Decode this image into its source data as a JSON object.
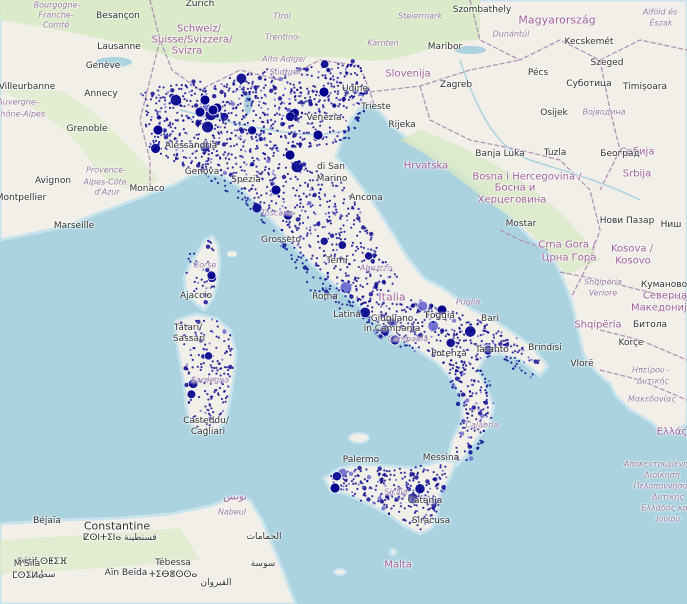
{
  "colors": {
    "sea": "#aad3df",
    "land": "#f2efe9",
    "green": "#cfe7b8",
    "border": "#b093b5",
    "coast_halo": "#c8e3ec",
    "marker_fill": "#00008b",
    "marker_light": "#6666cc"
  },
  "labels": {
    "countries": [
      {
        "id": "slovenija",
        "text": "Slovenija"
      },
      {
        "id": "hrvatska",
        "text": "Hrvatska"
      },
      {
        "id": "bosna",
        "text": "Bosna i Hercegovina /"
      },
      {
        "id": "bosna2",
        "text": "Босна и"
      },
      {
        "id": "bosna3",
        "text": "Херцеговина"
      },
      {
        "id": "magyar",
        "text": "Magyarország"
      },
      {
        "id": "srbija",
        "text": "Србија"
      },
      {
        "id": "srbija2",
        "text": "Srbija"
      },
      {
        "id": "cg",
        "text": "Crna Gora /"
      },
      {
        "id": "cg2",
        "text": "Црна Гора"
      },
      {
        "id": "kosovo",
        "text": "Kosova /"
      },
      {
        "id": "kosovo2",
        "text": "Kosovo"
      },
      {
        "id": "shqiperia",
        "text": "Shqipëria"
      },
      {
        "id": "makedonija",
        "text": "Северна"
      },
      {
        "id": "makedonija2",
        "text": "Македонија"
      },
      {
        "id": "italia",
        "text": "Italia"
      },
      {
        "id": "schweiz",
        "text": "Schweiz/"
      },
      {
        "id": "schweiz2",
        "text": "Suisse/Svizzera/"
      },
      {
        "id": "schweiz3",
        "text": "Svizra"
      },
      {
        "id": "ellas",
        "text": "Ελλάς"
      },
      {
        "id": "tunis",
        "text": "تونس"
      },
      {
        "id": "malta",
        "text": "Malta"
      }
    ],
    "cities": [
      {
        "id": "zurich",
        "text": "Zürich"
      },
      {
        "id": "besancon",
        "text": "Besançon"
      },
      {
        "id": "lausanne",
        "text": "Lausanne"
      },
      {
        "id": "geneve",
        "text": "Genève"
      },
      {
        "id": "annecy",
        "text": "Annecy"
      },
      {
        "id": "villeurbanne",
        "text": "Villeurbanne"
      },
      {
        "id": "grenoble",
        "text": "Grenoble"
      },
      {
        "id": "avignon",
        "text": "Avignon"
      },
      {
        "id": "montpellier",
        "text": "Montpellier"
      },
      {
        "id": "marseille",
        "text": "Marseille"
      },
      {
        "id": "monaco",
        "text": "Monaco"
      },
      {
        "id": "genova",
        "text": "Genova"
      },
      {
        "id": "alessandria",
        "text": "Alessandria"
      },
      {
        "id": "spezia",
        "text": "Spezia"
      },
      {
        "id": "grosseto",
        "text": "Grosseto"
      },
      {
        "id": "venezia",
        "text": "Venezia"
      },
      {
        "id": "udine",
        "text": "Udine"
      },
      {
        "id": "trieste",
        "text": "Trieste"
      },
      {
        "id": "rijeka",
        "text": "Rijeka"
      },
      {
        "id": "zagreb",
        "text": "Zagreb"
      },
      {
        "id": "maribor",
        "text": "Maribor"
      },
      {
        "id": "szombathely",
        "text": "Szombathely"
      },
      {
        "id": "kecskemet",
        "text": "Kecskemét"
      },
      {
        "id": "szeged",
        "text": "Szeged"
      },
      {
        "id": "pecs",
        "text": "Pécs"
      },
      {
        "id": "osijek",
        "text": "Osijek"
      },
      {
        "id": "subotica",
        "text": "Суботица"
      },
      {
        "id": "timisoara",
        "text": "Timișoara"
      },
      {
        "id": "banjaluka",
        "text": "Banja Luka"
      },
      {
        "id": "tuzla",
        "text": "Tuzla"
      },
      {
        "id": "beograd",
        "text": "Београд"
      },
      {
        "id": "mostar",
        "text": "Mostar"
      },
      {
        "id": "novipazar",
        "text": "Нови Пазар"
      },
      {
        "id": "nis",
        "text": "Ниш"
      },
      {
        "id": "kumanovo",
        "text": "Куманово"
      },
      {
        "id": "bitola",
        "text": "Битола"
      },
      {
        "id": "korce",
        "text": "Korçe"
      },
      {
        "id": "vlore",
        "text": "Vlorë"
      },
      {
        "id": "sanmarino",
        "text": "di San"
      },
      {
        "id": "sanmarino2",
        "text": "Marino"
      },
      {
        "id": "ancona",
        "text": "Ancona"
      },
      {
        "id": "terni",
        "text": "Terni"
      },
      {
        "id": "roma",
        "text": "Roma"
      },
      {
        "id": "latina",
        "text": "Latina"
      },
      {
        "id": "giugliano",
        "text": "Giugliano"
      },
      {
        "id": "giugliano2",
        "text": "in Campania"
      },
      {
        "id": "foggia",
        "text": "Foggia"
      },
      {
        "id": "bari",
        "text": "Bari"
      },
      {
        "id": "taranto",
        "text": "Taranto"
      },
      {
        "id": "brindisi",
        "text": "Brindisi"
      },
      {
        "id": "potenza",
        "text": "Potenza"
      },
      {
        "id": "messina",
        "text": "Messina"
      },
      {
        "id": "palermo",
        "text": "Palermo"
      },
      {
        "id": "catania",
        "text": "Catania"
      },
      {
        "id": "siracusa",
        "text": "Siracusa"
      },
      {
        "id": "ajaccio",
        "text": "Ajaccio"
      },
      {
        "id": "sassari",
        "text": "Tàtari/"
      },
      {
        "id": "sassari2",
        "text": "Sassari"
      },
      {
        "id": "cagliari",
        "text": "Casteddu/"
      },
      {
        "id": "cagliari2",
        "text": "Cagliari"
      },
      {
        "id": "constantine",
        "text": "Constantine"
      },
      {
        "id": "constantine2",
        "text": "ⵇⵙⵏⵜⵉⵏⴰ قسنطينة"
      },
      {
        "id": "bejaia",
        "text": "Béjaïa"
      },
      {
        "id": "setif",
        "text": "Sétif ⵙⵟⵉⴼ"
      },
      {
        "id": "setif2",
        "text": "سطيف"
      },
      {
        "id": "msila",
        "text": "M'Sila"
      },
      {
        "id": "msila2",
        "text": "ⵎⵙⵉⵍⴰ"
      },
      {
        "id": "ainbeida",
        "text": "Aïn Beïda"
      },
      {
        "id": "tebessa",
        "text": "Tébessa"
      },
      {
        "id": "tebessa2",
        "text": "ⵜⵉⴱⴻⵙⵙⴰ"
      },
      {
        "id": "sousse",
        "text": "سوسة"
      },
      {
        "id": "kairouan",
        "text": "القيروان"
      },
      {
        "id": "hammamet",
        "text": "الحمامات"
      },
      {
        "id": "tirol",
        "text": "Tirol"
      },
      {
        "id": "karnten",
        "text": "Kärnten"
      },
      {
        "id": "steiermark",
        "text": "Steiermark"
      },
      {
        "id": "dunantul",
        "text": "Dunántúl"
      },
      {
        "id": "trentino",
        "text": "Trentino-"
      },
      {
        "id": "trentino2",
        "text": "Alto Adige/"
      },
      {
        "id": "trentino3",
        "text": "Südtirol"
      },
      {
        "id": "bourgogne",
        "text": "Bourgogne-"
      },
      {
        "id": "bourgogne2",
        "text": "Franche-"
      },
      {
        "id": "bourgogne3",
        "text": "Comté"
      },
      {
        "id": "auvergne",
        "text": "Auvergne-"
      },
      {
        "id": "auvergne2",
        "text": "Rhône-Alpes"
      },
      {
        "id": "provence",
        "text": "Provence-"
      },
      {
        "id": "provence2",
        "text": "Alpes-Côte"
      },
      {
        "id": "provence3",
        "text": "d'Azur"
      },
      {
        "id": "vojvodina",
        "text": "Војводина"
      },
      {
        "id": "alfold",
        "text": "Alföld és"
      },
      {
        "id": "alfold2",
        "text": "Észak"
      },
      {
        "id": "toscana",
        "text": "Toscana"
      },
      {
        "id": "puglia",
        "text": "Puglia"
      },
      {
        "id": "calabria",
        "text": "Calabria"
      },
      {
        "id": "sicilia",
        "text": "Sicilia"
      },
      {
        "id": "sardegna",
        "text": "Sardegna"
      },
      {
        "id": "corse",
        "text": "Corse"
      },
      {
        "id": "campania",
        "text": "Campania"
      },
      {
        "id": "abruzzo",
        "text": "Abruzzo"
      },
      {
        "id": "peloponnese",
        "text": "Αποκεντρωμένη"
      },
      {
        "id": "peloponnese2",
        "text": "Διοίκηση"
      },
      {
        "id": "peloponnese3",
        "text": "Πελοποννήσου,"
      },
      {
        "id": "peloponnese4",
        "text": "Δυτικής"
      },
      {
        "id": "peloponnese5",
        "text": "Ελλάδος και"
      },
      {
        "id": "peloponnese6",
        "text": "Ιονίου"
      },
      {
        "id": "epirus",
        "text": "Ηπείρου -"
      },
      {
        "id": "epirus2",
        "text": "Δυτικής"
      },
      {
        "id": "epirus3",
        "text": "Μακεδονίας"
      },
      {
        "id": "shqverore",
        "text": "Shqipëria"
      },
      {
        "id": "shqverore2",
        "text": "Veriore"
      },
      {
        "id": "nabeul",
        "text": "Nabeul"
      }
    ]
  }
}
